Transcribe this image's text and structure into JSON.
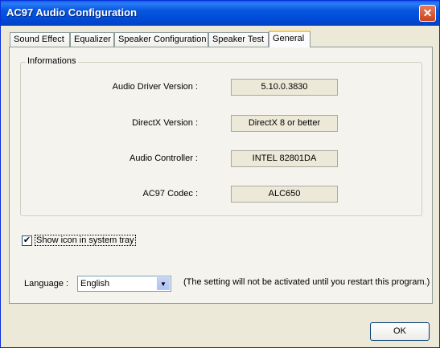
{
  "window": {
    "title": "AC97 Audio Configuration",
    "close_glyph": "✕"
  },
  "tabs": [
    {
      "label": "Sound Effect",
      "active": false
    },
    {
      "label": "Equalizer",
      "active": false
    },
    {
      "label": "Speaker Configuration",
      "active": false
    },
    {
      "label": "Speaker Test",
      "active": false
    },
    {
      "label": "General",
      "active": true
    }
  ],
  "informations": {
    "group_label": "Informations",
    "rows": [
      {
        "label": "Audio Driver Version :",
        "value": "5.10.0.3830"
      },
      {
        "label": "DirectX Version :",
        "value": "DirectX 8 or better"
      },
      {
        "label": "Audio Controller :",
        "value": "INTEL 82801DA"
      },
      {
        "label": "AC97 Codec :",
        "value": "ALC650"
      }
    ]
  },
  "tray_option": {
    "label": "Show icon in system tray",
    "checked": true,
    "check_glyph": "✔"
  },
  "language": {
    "label": "Language :",
    "selected": "English",
    "note": "(The setting will not be activated until you restart this program.)"
  },
  "buttons": {
    "ok_label": "OK"
  }
}
